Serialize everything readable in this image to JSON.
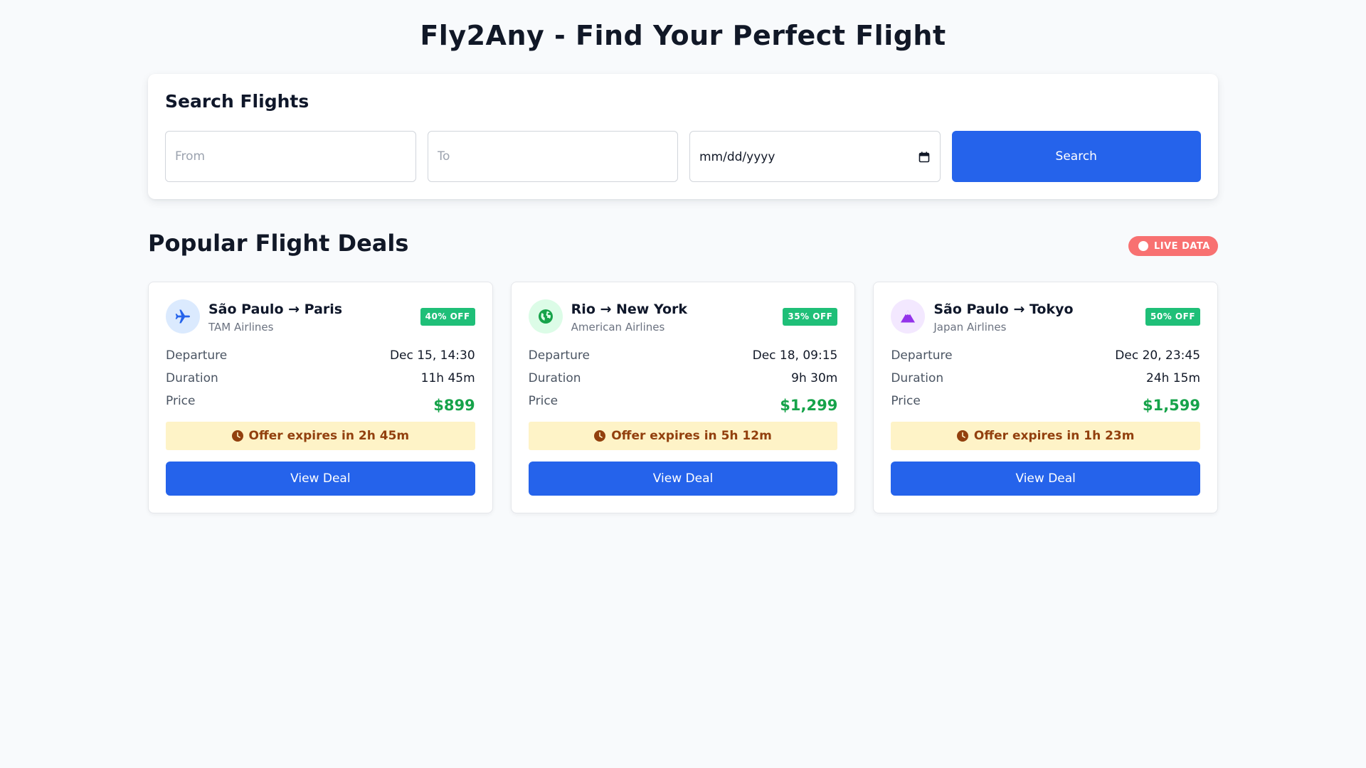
{
  "page": {
    "title": "Fly2Any - Find Your Perfect Flight"
  },
  "search": {
    "title": "Search Flights",
    "from_placeholder": "From",
    "to_placeholder": "To",
    "date_placeholder": "mm/dd/yyyy",
    "button_label": "Search"
  },
  "deals": {
    "title": "Popular Flight Deals",
    "live_badge": "LIVE DATA",
    "live_badge_color": "#f87171",
    "labels": {
      "departure": "Departure",
      "duration": "Duration",
      "price": "Price"
    },
    "items": [
      {
        "route": "São Paulo → Paris",
        "airline": "TAM Airlines",
        "discount": "40% OFF",
        "departure": "Dec 15, 14:30",
        "duration": "11h 45m",
        "price": "$899",
        "expiry": "Offer expires in 2h 45m",
        "button_label": "View Deal",
        "icon": "plane-icon",
        "icon_color": "#2563eb",
        "icon_bg": "#dbeafe"
      },
      {
        "route": "Rio → New York",
        "airline": "American Airlines",
        "discount": "35% OFF",
        "departure": "Dec 18, 09:15",
        "duration": "9h 30m",
        "price": "$1,299",
        "expiry": "Offer expires in 5h 12m",
        "button_label": "View Deal",
        "icon": "globe-icon",
        "icon_color": "#16a34a",
        "icon_bg": "#dcfce7"
      },
      {
        "route": "São Paulo → Tokyo",
        "airline": "Japan Airlines",
        "discount": "50% OFF",
        "departure": "Dec 20, 23:45",
        "duration": "24h 15m",
        "price": "$1,599",
        "expiry": "Offer expires in 1h 23m",
        "button_label": "View Deal",
        "icon": "mountain-icon",
        "icon_color": "#9333ea",
        "icon_bg": "#f3e8ff"
      }
    ]
  },
  "colors": {
    "primary": "#2563eb",
    "price": "#16a34a",
    "discount_badge": "#1fbf78",
    "expiry_bg": "#fef3c7",
    "expiry_text": "#92400e"
  }
}
